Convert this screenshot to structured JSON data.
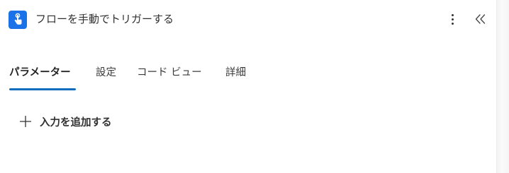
{
  "header": {
    "title": "フローを手動でトリガーする",
    "icon": "touch-hand-icon",
    "icon_color": "#1b72e8",
    "more_icon": "more-vertical-icon",
    "collapse_icon": "double-chevron-left-icon"
  },
  "tabs": [
    {
      "label": "パラメーター",
      "active": true
    },
    {
      "label": "設定",
      "active": false
    },
    {
      "label": "コード ビュー",
      "active": false
    },
    {
      "label": "詳細",
      "active": false
    }
  ],
  "accent_color": "#0f6cbd",
  "parameters": {
    "add_label": "入力を追加する",
    "add_icon": "plus-icon"
  }
}
